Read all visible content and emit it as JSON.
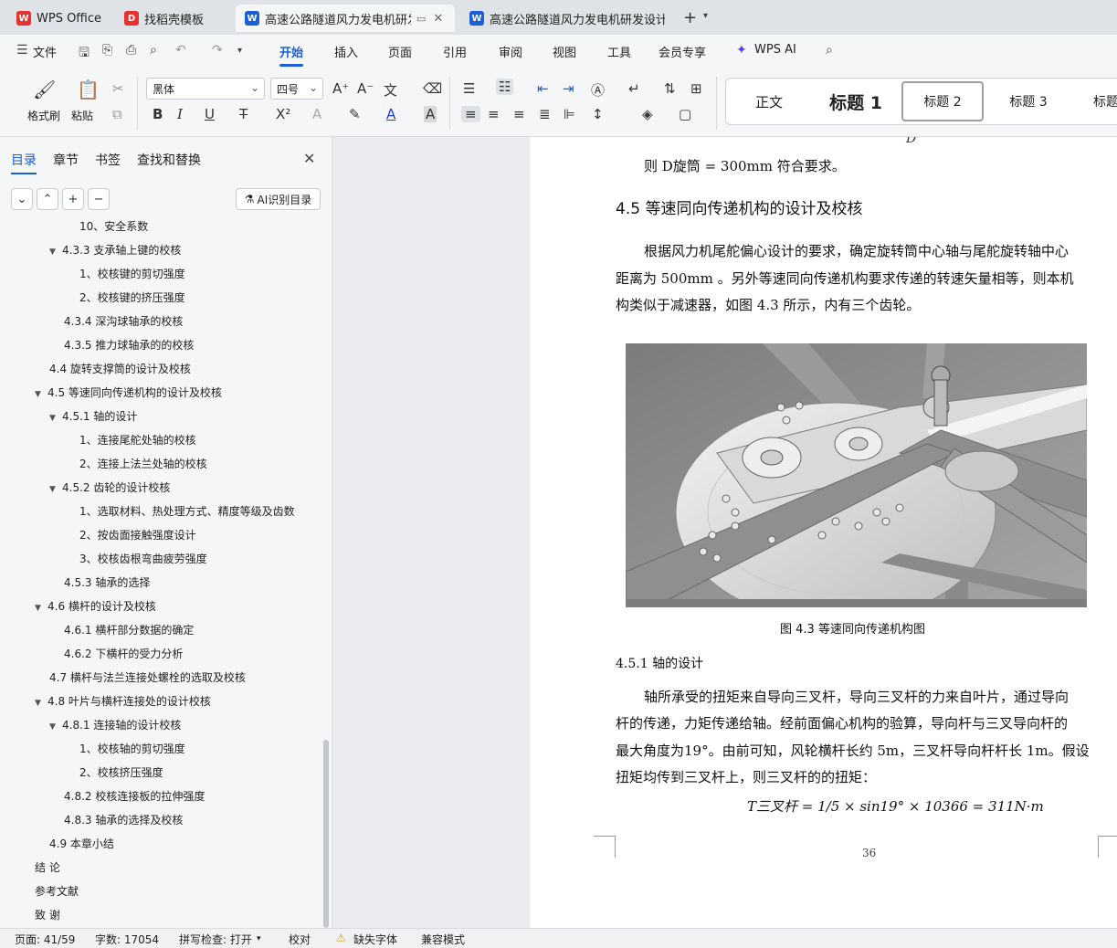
{
  "tabs": [
    {
      "label": "WPS Office",
      "icon": "wps-logo-icon",
      "color": "#e6312e"
    },
    {
      "label": "找稻壳模板",
      "icon": "docer-icon",
      "color": "#e6312e"
    },
    {
      "label": "高速公路隧道风力发电机研发",
      "icon": "word-doc-icon",
      "color": "#1a5fd6",
      "active": true
    },
    {
      "label": "高速公路隧道风力发电机研发设计 说",
      "icon": "word-doc-icon",
      "color": "#1a5fd6"
    }
  ],
  "menu": {
    "file": "文件",
    "items": [
      "开始",
      "插入",
      "页面",
      "引用",
      "审阅",
      "视图",
      "工具",
      "会员专享"
    ],
    "active": "开始",
    "wps_ai": "WPS AI"
  },
  "ribbon": {
    "format_painter": "格式刷",
    "paste": "粘贴",
    "font_name": "黑体",
    "font_size": "四号",
    "styles": [
      {
        "label": "正文"
      },
      {
        "label": "标题  1"
      },
      {
        "label": "标题  2",
        "selected": true
      },
      {
        "label": "标题  3"
      },
      {
        "label": "标题"
      }
    ]
  },
  "nav": {
    "tabs": [
      "目录",
      "章节",
      "书签",
      "查找和替换"
    ],
    "active_tab": "目录",
    "ai_button": "AI识别目录",
    "toc": [
      {
        "label": "10、安全系数",
        "level": 3
      },
      {
        "label": "4.3.3  支承轴上键的校核",
        "level": 2,
        "expanded": true
      },
      {
        "label": "1、校核键的剪切强度",
        "level": 3
      },
      {
        "label": "2、校核键的挤压强度",
        "level": 3
      },
      {
        "label": "4.3.4  深沟球轴承的校核",
        "level": 2
      },
      {
        "label": "4.3.5  推力球轴承的的校核",
        "level": 2
      },
      {
        "label": "4.4  旋转支撑筒的设计及校核",
        "level": 1
      },
      {
        "label": "4.5  等速同向传递机构的设计及校核",
        "level": 1,
        "expanded": true
      },
      {
        "label": "4.5.1  轴的设计",
        "level": 2,
        "expanded": true
      },
      {
        "label": "1、连接尾舵处轴的校核",
        "level": 3
      },
      {
        "label": "2、连接上法兰处轴的校核",
        "level": 3
      },
      {
        "label": "4.5.2  齿轮的设计校核",
        "level": 2,
        "expanded": true
      },
      {
        "label": "1、选取材料、热处理方式、精度等级及齿数",
        "level": 3
      },
      {
        "label": "2、按齿面接触强度设计",
        "level": 3
      },
      {
        "label": "3、校核齿根弯曲疲劳强度",
        "level": 3
      },
      {
        "label": "4.5.3  轴承的选择",
        "level": 2
      },
      {
        "label": "4.6  横杆的设计及校核",
        "level": 1,
        "expanded": true
      },
      {
        "label": "4.6.1  横杆部分数据的确定",
        "level": 2
      },
      {
        "label": "4.6.2  下横杆的受力分析",
        "level": 2
      },
      {
        "label": "4.7  横杆与法兰连接处螺栓的选取及校核",
        "level": 1
      },
      {
        "label": "4.8  叶片与横杆连接处的设计校核",
        "level": 1,
        "expanded": true
      },
      {
        "label": "4.8.1  连接轴的设计校核",
        "level": 2,
        "expanded": true
      },
      {
        "label": "1、校核轴的剪切强度",
        "level": 3
      },
      {
        "label": "2、校核挤压强度",
        "level": 3
      },
      {
        "label": "4.8.2  校核连接板的拉伸强度",
        "level": 2
      },
      {
        "label": "4.8.3  轴承的选择及校核",
        "level": 2
      },
      {
        "label": "4.9  本章小结",
        "level": 1
      },
      {
        "label": "结    论",
        "level": 0
      },
      {
        "label": "参考文献",
        "level": 0
      },
      {
        "label": "致    谢",
        "level": 0
      }
    ]
  },
  "document": {
    "top_line_formula": "则 D旋筒 = 300mm 符合要求。",
    "section_heading": "4.5  等速同向传递机构的设计及校核",
    "para1": [
      "根据风力机尾舵偏心设计的要求，确定旋转筒中心轴与尾舵旋转轴中心",
      "距离为 500mm 。另外等速同向传递机构要求传递的转速矢量相等，则本机",
      "构类似于减速器，如图 4.3 所示，内有三个齿轮。"
    ],
    "figure_caption": "图 4.3 等速同向传递机构图",
    "subsection_heading": "4.5.1  轴的设计",
    "para2": [
      "轴所承受的扭矩来自导向三叉杆，导向三叉杆的力来自叶片，通过导向",
      "杆的传递，力矩传递给轴。经前面偏心机构的验算，导向杆与三叉导向杆的",
      "最大角度为19°。由前可知，风轮横杆长约 5m，三叉杆导向杆杆长 1m。假设",
      "扭矩均传到三叉杆上，则三叉杆的的扭矩："
    ],
    "formula": "T三叉杆 = 1/5 × sin19° × 10366 = 311N·m",
    "page_number": "36"
  },
  "status": {
    "page": "页面: 41/59",
    "words": "字数: 17054",
    "spell": "拼写检查: 打开",
    "proof": "校对",
    "missing_font": "缺失字体",
    "compat": "兼容模式"
  }
}
